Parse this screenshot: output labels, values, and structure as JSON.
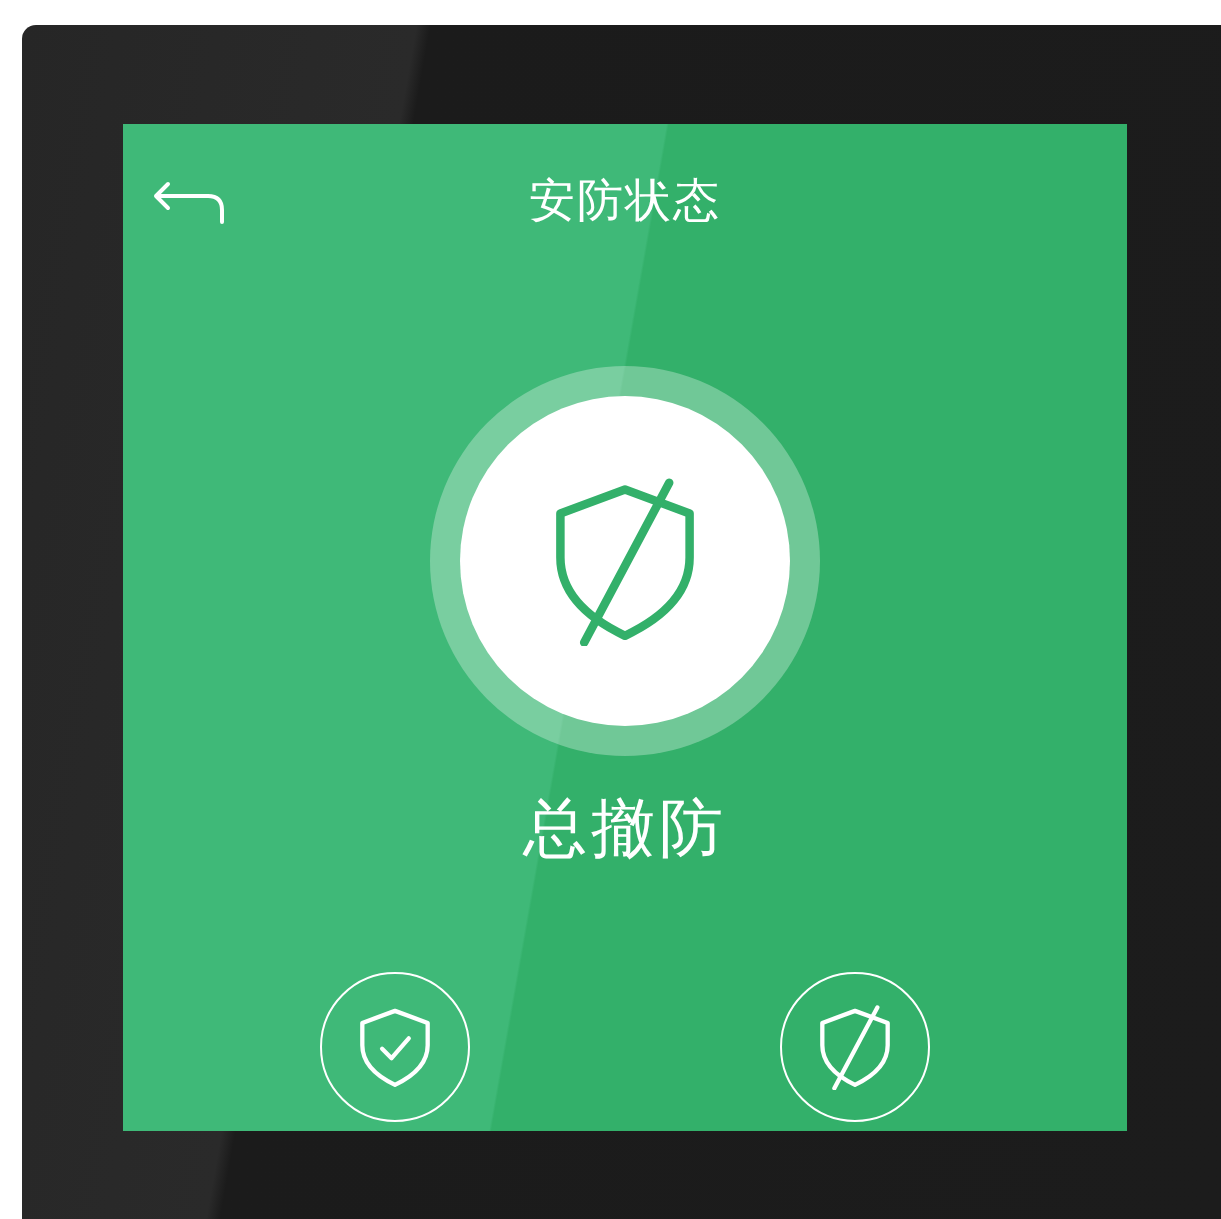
{
  "screen": {
    "title": "安防状态",
    "armed": false,
    "status": "总撤防",
    "mode_buttons": [
      {
        "kind": "arm"
      },
      {
        "kind": "disarm"
      }
    ]
  }
}
